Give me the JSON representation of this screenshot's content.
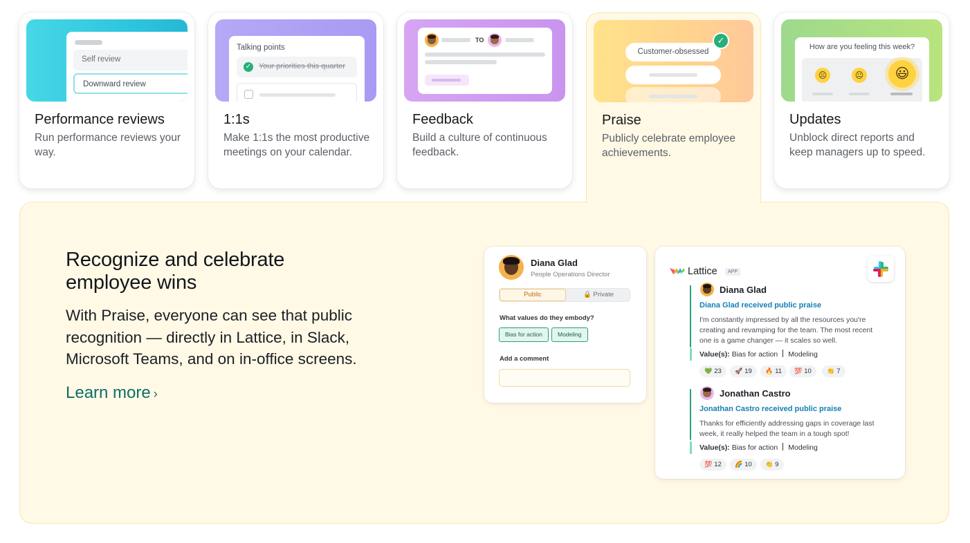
{
  "cards": [
    {
      "title": "Performance reviews",
      "desc": "Run performance reviews your way.",
      "thumb": {
        "row1": "Self review",
        "row2": "Downward review"
      }
    },
    {
      "title": "1:1s",
      "desc": "Make 1:1s the most productive meetings on your calendar.",
      "thumb": {
        "label": "Talking points",
        "item": "Your priorities this quarter"
      }
    },
    {
      "title": "Feedback",
      "desc": "Build a culture of continuous feedback.",
      "thumb": {
        "to": "TO"
      }
    },
    {
      "title": "Praise",
      "desc": "Publicly celebrate employee achievements.",
      "thumb": {
        "pill": "Customer-obsessed",
        "check": "✓"
      }
    },
    {
      "title": "Updates",
      "desc": "Unblock direct reports and keep managers up to speed.",
      "thumb": {
        "question": "How are you feeling this week?",
        "e1": "☹",
        "e2": "😐",
        "e3": "😃"
      }
    }
  ],
  "praise": {
    "heading": "Recognize and celebrate employee wins",
    "body": "With Praise, everyone can see that public recognition — directly in Lattice, in Slack, Microsoft Teams, and on in-office screens.",
    "learn_more": "Learn more",
    "chevron": "›",
    "form": {
      "name": "Diana Glad",
      "role": "People Operations Director",
      "tab_public": "Public",
      "tab_private": "🔒 Private",
      "question": "What values do they embody?",
      "tags": [
        "Bias for action",
        "Modeling"
      ],
      "comment_label": "Add a comment",
      "comment_value": ""
    },
    "slack": {
      "brand": "Lattice",
      "app_badge": "APP",
      "messages": [
        {
          "author": "Diana Glad",
          "headline": "Diana Glad received public praise",
          "text": "I'm constantly impressed by all the resources you're creating and revamping for the team. The most recent one is a game changer — it scales so well.",
          "values_label": "Value(s):",
          "value1": "Bias for action",
          "value2": "Modeling",
          "reactions": [
            {
              "icon": "💚",
              "count": "23"
            },
            {
              "icon": "🚀",
              "count": "19"
            },
            {
              "icon": "🔥",
              "count": "11"
            },
            {
              "icon": "💯",
              "count": "10"
            },
            {
              "icon": "👏",
              "count": "7"
            }
          ]
        },
        {
          "author": "Jonathan Castro",
          "headline": "Jonathan Castro received public praise",
          "text": "Thanks for efficiently addressing gaps in coverage last week, it really helped the team in a tough spot!",
          "values_label": "Value(s):",
          "value1": "Bias for action",
          "value2": "Modeling",
          "reactions": [
            {
              "icon": "💯",
              "count": "12"
            },
            {
              "icon": "🌈",
              "count": "10"
            },
            {
              "icon": "👏",
              "count": "9"
            }
          ]
        }
      ]
    }
  }
}
